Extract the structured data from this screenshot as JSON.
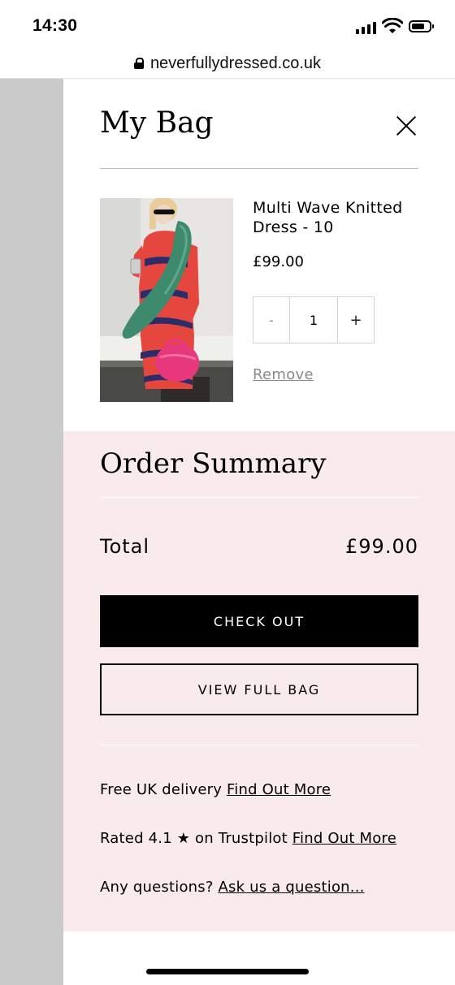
{
  "status_bar": {
    "time": "14:30"
  },
  "browser": {
    "url": "neverfullydressed.co.uk"
  },
  "bag": {
    "title": "My Bag",
    "item": {
      "name": "Multi Wave Knitted Dress - 10",
      "price": "£99.00",
      "quantity": "1",
      "minus_label": "-",
      "plus_label": "+",
      "remove_label": "Remove"
    }
  },
  "summary": {
    "title": "Order Summary",
    "total_label": "Total",
    "total_value": "£99.00",
    "checkout_label": "CHECK OUT",
    "view_bag_label": "VIEW FULL BAG",
    "delivery_text": "Free UK delivery ",
    "delivery_link": "Find Out More",
    "rating_text": "Rated 4.1 ★ on Trustpilot ",
    "rating_link": "Find Out More",
    "questions_text": "Any questions? ",
    "questions_link": "Ask us a question..."
  },
  "colors": {
    "summary_bg": "#f9ebeb",
    "overlay_gray": "#cacaca",
    "checkout_bg": "#000000"
  },
  "icons": [
    "signal-icon",
    "wifi-icon",
    "battery-icon",
    "lock-icon",
    "close-icon"
  ]
}
